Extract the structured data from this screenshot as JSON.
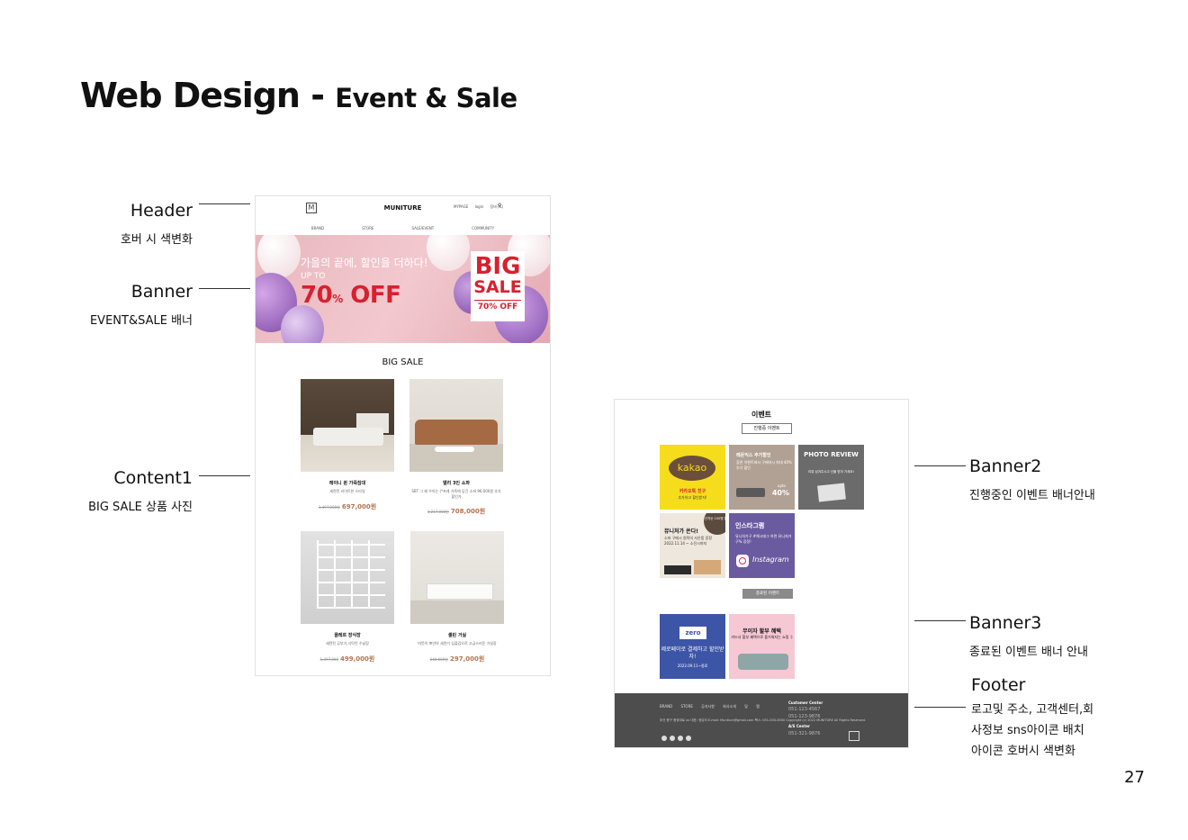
{
  "title": {
    "main": "Web Design - ",
    "sub": "Event & Sale"
  },
  "page_number": "27",
  "annotations": {
    "header": {
      "label": "Header",
      "desc": "호버 시 색변화"
    },
    "banner": {
      "label": "Banner",
      "desc": "EVENT&SALE 배너"
    },
    "content1": {
      "label": "Content1",
      "desc": "BIG SALE 상품 사진"
    },
    "banner2": {
      "label": "Banner2",
      "desc": "진행중인 이벤트 배너안내"
    },
    "banner3": {
      "label": "Banner3",
      "desc": "종료된 이벤트 배너 안내"
    },
    "footer": {
      "label": "Footer",
      "desc1": "로고및 주소, 고객센터,회",
      "desc2": "사정보 sns아이콘 배치",
      "desc3": "아이콘 호버시 색변화"
    }
  },
  "mock1": {
    "brand": "MUNITURE",
    "util": "MYPAGE login 장바구니",
    "nav": [
      "BRAND",
      "STORE",
      "SALE/EVENT",
      "COMMUNITY"
    ],
    "banner": {
      "headline": "가을의 끝에, 할인을 더하다!",
      "upto": "UP TO",
      "off": "70",
      "off_pct": "%",
      "off_word": " OFF",
      "big": "BIG",
      "sale": "SALE",
      "pct": "70% OFF"
    },
    "section_title": "BIG SALE",
    "products": [
      {
        "name": "레이니 퀸 가죽침대",
        "desc": "세련된 라이트한 스타일",
        "old": "1,497,000원",
        "new": "697,000원"
      },
      {
        "name": "엘리 3인 소파",
        "desc": "SBT 그 왜 우아는 (*프레 가죽에 담긴 소파 \n 96,000원 추가 할인가",
        "old": "1,217,000원",
        "new": "708,000원"
      },
      {
        "name": "플레르 장식장",
        "desc": "세련된 공부가,식탁된 수납장",
        "old": "1,397,000",
        "new": "499,000원"
      },
      {
        "name": "셀린 거실",
        "desc": "따뜻이 뽀얀의 세련거 심플감으로 \n 고급스러운 거실장",
        "old": "640,000원",
        "new": "297,000원"
      }
    ]
  },
  "mock2": {
    "title": "이벤트",
    "ongoing_btn": "진행중 이벤트",
    "ended_btn": "종료된 이벤트",
    "tiles": {
      "kakao": {
        "logo": "kakao",
        "t1": "카카오톡 친구",
        "t2": "추가하고 할인받자!"
      },
      "review": {
        "h": "레몬익스 추가할인",
        "h2": "참관 이벤트에서 구매하시 \n 최대 40% 추가 할인",
        "upto": "upto",
        "pct": "40%"
      },
      "photo": {
        "h": "PHOTO \n REVIEW",
        "h2": "리뷰 남겨주시고 \n 선물 받아 가세요!"
      },
      "muni": {
        "h": "뮤니처가 쏜다!",
        "h2": "소파 구매시 \n 원목의 사은품 증정 \n 2022.11.14 \n ~ 소진시까지",
        "circle": "선착순 100명 한정"
      },
      "insta": {
        "h": "인스타그램",
        "h2": "뮤니처가구 #해시태그 하면 \n 뮤니처가구% 증정!",
        "word": "Instagram"
      },
      "zero": {
        "logo": "zero",
        "h": "제로페이로 \n 결제하고 할인받자!",
        "d": "2022.09.11~종료"
      },
      "pink": {
        "h": "무이자 할부 혜택",
        "h2": "카드사 할부 혜택으로 \n 즐거워지는 쇼핑 :)"
      }
    },
    "footer": {
      "nav": "BRAND STORE 공지사항 회사소개 및 멤",
      "addr": "부산 중구 중앙대로 xx    대표: 정뮤처 \n E-mail: Muniture@gmail.com  팩스: 051-000-0000 \n Copyright (c) 2022 MUNITURE All Rights Reserved.",
      "cc_title": "Customer Center",
      "cc1": "051-123-4567",
      "cc2": "051-123-9876",
      "as_title": "A/S Center",
      "as1": "051-321-9876"
    }
  }
}
